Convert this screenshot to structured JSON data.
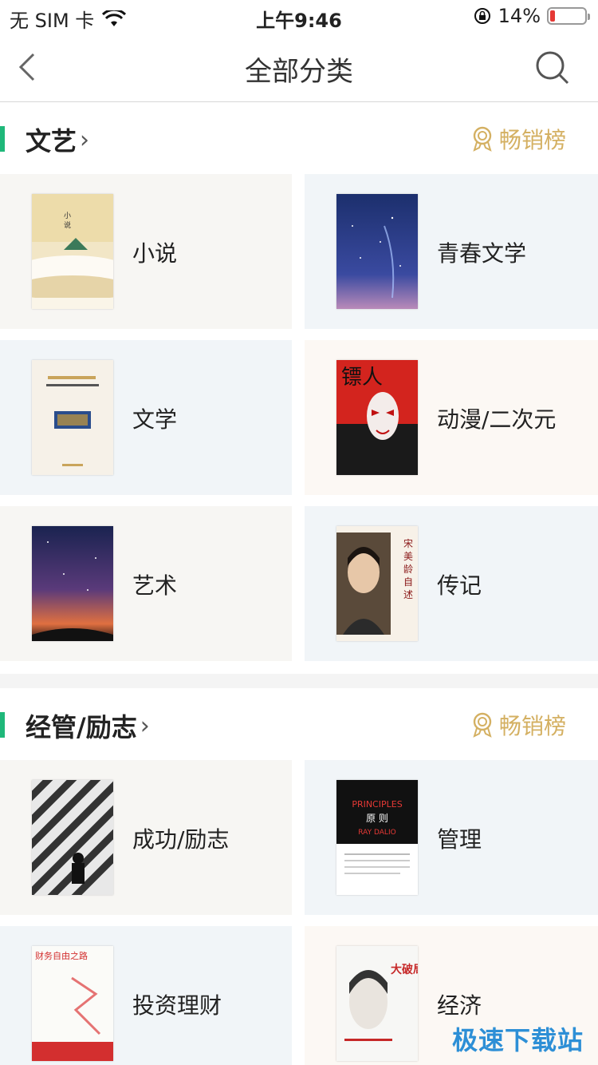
{
  "status": {
    "carrier": "无 SIM 卡",
    "time": "上午9:46",
    "battery": "14%",
    "battery_level": 0.14
  },
  "nav": {
    "title": "全部分类"
  },
  "colors": {
    "accent": "#1fb87a",
    "gold": "#d4b062",
    "battery_low": "#e53935"
  },
  "sections": [
    {
      "title": "文艺",
      "bestseller": "畅销榜",
      "tiles": [
        {
          "label": "小说",
          "cover_icon": "misty-mountain-book-cover"
        },
        {
          "label": "青春文学",
          "cover_icon": "starry-night-book-cover"
        },
        {
          "label": "文学",
          "cover_icon": "cream-book-cover"
        },
        {
          "label": "动漫/二次元",
          "cover_icon": "mask-book-cover"
        },
        {
          "label": "艺术",
          "cover_icon": "galaxy-book-cover"
        },
        {
          "label": "传记",
          "cover_icon": "portrait-book-cover"
        }
      ]
    },
    {
      "title": "经管/励志",
      "bestseller": "畅销榜",
      "tiles": [
        {
          "label": "成功/励志",
          "cover_icon": "striped-book-cover"
        },
        {
          "label": "管理",
          "cover_icon": "principles-book-cover"
        },
        {
          "label": "投资理财",
          "cover_icon": "finance-book-cover"
        },
        {
          "label": "经济",
          "cover_icon": "woman-portrait-book-cover"
        }
      ]
    }
  ],
  "covers": {
    "xiaoshuo_title": "宋美龄自述",
    "principles_title": "PRINCIPLES",
    "principles_cn": "原 则",
    "principles_author": "RAY DALIO",
    "finance_title": "财务自由之路",
    "economy_title": "大破局",
    "manga_title": "镖人"
  },
  "watermark": "极速下载站"
}
